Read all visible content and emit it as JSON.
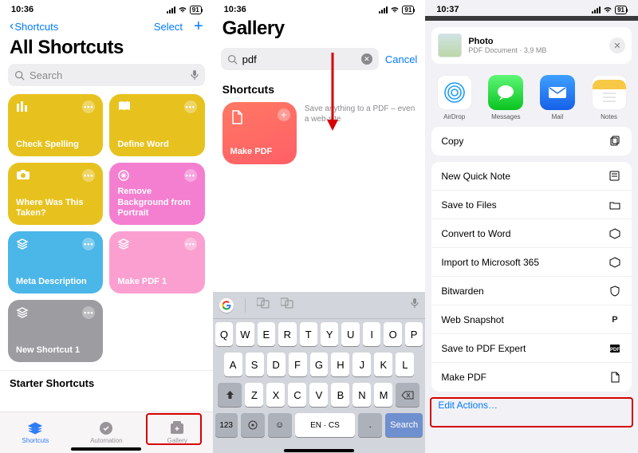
{
  "status": {
    "time1": "10:36",
    "time2": "10:36",
    "time3": "10:37",
    "battery": "91"
  },
  "s1": {
    "back": "Shortcuts",
    "select": "Select",
    "title": "All Shortcuts",
    "search_ph": "Search",
    "tiles": [
      {
        "label": "Check Spelling",
        "icon": "bars",
        "bg": "#e7c21f"
      },
      {
        "label": "Define Word",
        "icon": "book",
        "bg": "#e7c21f"
      },
      {
        "label": "Where Was This Taken?",
        "icon": "camera",
        "bg": "#e7c21f"
      },
      {
        "label": "Remove Background from Portrait",
        "icon": "sparkle",
        "bg": "#f47fd0"
      },
      {
        "label": "Meta Description",
        "icon": "stack",
        "bg": "#4bb6e8"
      },
      {
        "label": "Make PDF 1",
        "icon": "stack",
        "bg": "#fa9fd0"
      },
      {
        "label": "New Shortcut 1",
        "icon": "stack",
        "bg": "#9c9ca1"
      }
    ],
    "section2": "Starter Shortcuts",
    "tabs": {
      "shortcuts": "Shortcuts",
      "automation": "Automation",
      "gallery": "Gallery"
    }
  },
  "s2": {
    "title": "Gallery",
    "query": "pdf",
    "cancel": "Cancel",
    "section": "Shortcuts",
    "card": "Make PDF",
    "desc": "Save anything to a PDF – even a web-site",
    "kb": {
      "r1": [
        "Q",
        "W",
        "E",
        "R",
        "T",
        "Y",
        "U",
        "I",
        "O",
        "P"
      ],
      "r2": [
        "A",
        "S",
        "D",
        "F",
        "G",
        "H",
        "J",
        "K",
        "L"
      ],
      "r3": [
        "Z",
        "X",
        "C",
        "V",
        "B",
        "N",
        "M"
      ],
      "num": "123",
      "lang": "EN · CS",
      "search": "Search"
    }
  },
  "s3": {
    "file": {
      "name": "Photo",
      "sub": "PDF Document · 3,9 MB"
    },
    "apps": [
      {
        "name": "AirDrop",
        "bg": "#fff",
        "fg": "#1e9df4"
      },
      {
        "name": "Messages",
        "bg": "#30d158",
        "fg": "#fff"
      },
      {
        "name": "Mail",
        "bg": "#1e6ff1",
        "fg": "#fff"
      },
      {
        "name": "Notes",
        "bg": "#fff",
        "fg": "#f7c846"
      }
    ],
    "actions": [
      "Copy",
      "New Quick Note",
      "Save to Files",
      "Convert to Word",
      "Import to Microsoft 365",
      "Bitwarden",
      "Web Snapshot",
      "Save to PDF Expert",
      "Make PDF"
    ],
    "edit": "Edit Actions…"
  }
}
